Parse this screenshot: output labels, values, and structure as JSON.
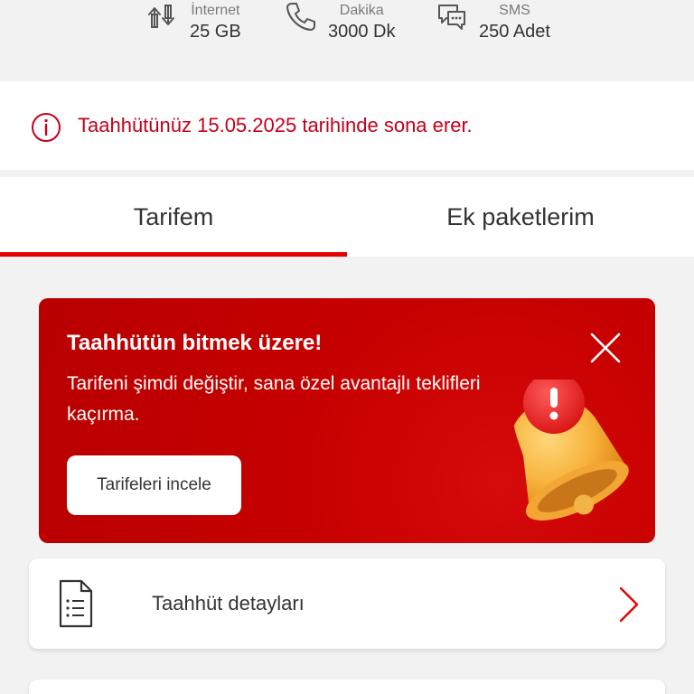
{
  "usage": [
    {
      "label": "İnternet",
      "value": "25 GB",
      "icon": "data-transfer-icon"
    },
    {
      "label": "Dakika",
      "value": "3000 Dk",
      "icon": "phone-icon"
    },
    {
      "label": "SMS",
      "value": "250 Adet",
      "icon": "chat-bubbles-icon"
    }
  ],
  "notice": {
    "text": "Taahhütünüz 15.05.2025 tarihinde sona erer.",
    "icon": "info-icon"
  },
  "tabs": [
    {
      "label": "Tarifem",
      "active": true
    },
    {
      "label": "Ek paketlerim",
      "active": false
    }
  ],
  "promo": {
    "title": "Taahhütün bitmek üzere!",
    "subtitle": "Tarifeni şimdi değiştir, sana özel avantajlı teklifleri kaçırma.",
    "button": "Tarifeleri incele",
    "close_icon": "close-icon",
    "illustration": "bell-alert-icon"
  },
  "rows": [
    {
      "label": "Taahhüt detayları",
      "icon": "document-icon",
      "chevron": "chevron-right-icon"
    }
  ],
  "colors": {
    "brand_red": "#e60000",
    "banner_red": "#c60000",
    "notice_text": "#c4001a",
    "background": "#f2f2f2"
  }
}
